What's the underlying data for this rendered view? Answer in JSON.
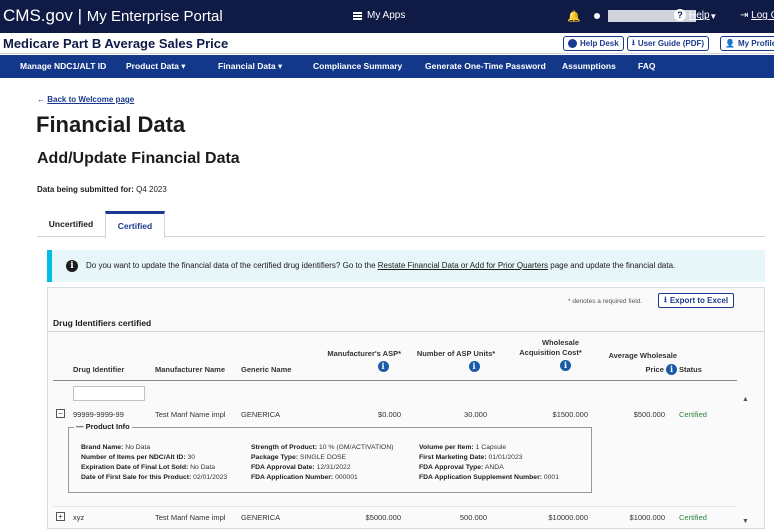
{
  "topbar": {
    "brand": "CMS.gov",
    "portal": "My Enterprise Portal",
    "myapps_label": "My Apps",
    "help_label": "Help",
    "logout_label": "Log O"
  },
  "app": {
    "title": "Medicare Part B Average Sales Price",
    "help_desk_label": "Help Desk",
    "user_guide_label": "User Guide (PDF)",
    "my_profile_label": "My Profile"
  },
  "nav": {
    "items": [
      {
        "label": "Manage NDC1/ALT ID"
      },
      {
        "label": "Product Data ▾"
      },
      {
        "label": "Financial Data ▾"
      },
      {
        "label": "Compliance Summary"
      },
      {
        "label": "Generate One-Time Password"
      },
      {
        "label": "Assumptions"
      },
      {
        "label": "FAQ"
      }
    ]
  },
  "main": {
    "back_label": "Back to Welcome page",
    "page_title": "Financial Data",
    "section_title": "Add/Update Financial Data",
    "submitted_label": "Data being submitted for:",
    "submitted_value": "Q4 2023",
    "tabs": [
      {
        "label": "Uncertified"
      },
      {
        "label": "Certified"
      }
    ],
    "alert": {
      "text_before": "Do you want to update the financial data of the certified drug identifiers? Go to the ",
      "link": "Restate Financial Data or Add for Prior Quarters",
      "text_after": " page and update the financial data."
    }
  },
  "table": {
    "required_note": "* denotes a required field.",
    "export_label": "Export to Excel",
    "section_label": "Drug Identifiers certified",
    "headers": {
      "drug_identifier": "Drug Identifier",
      "manufacturer_name": "Manufacturer Name",
      "generic_name": "Generic Name",
      "manufacturer_asp": "Manufacturer's ASP*",
      "asp_units": "Number of ASP Units*",
      "wac_line1": "Wholesale",
      "wac_line2": "Acquisition Cost*",
      "awp_line1": "Average Wholesale",
      "awp_line2": "Price",
      "status": "Status"
    },
    "rows": [
      {
        "drug_identifier": "99999-9999-99",
        "manufacturer_name": "Test Manf Name impl",
        "generic_name": "GENERICA",
        "asp": "$0.000",
        "units": "30.000",
        "wac": "$1500.000",
        "awp": "$500.000",
        "status": "Certified",
        "expander": "−"
      },
      {
        "drug_identifier": "xyz",
        "manufacturer_name": "Test Manf Name impl",
        "generic_name": "GENERICA",
        "asp": "$5000.000",
        "units": "500.000",
        "wac": "$10000.000",
        "awp": "$1000.000",
        "status": "Certified",
        "expander": "+"
      }
    ],
    "product_info": {
      "legend": "Product Info",
      "brand_name_label": "Brand Name:",
      "brand_name": "No Data",
      "items_label": "Number of Items per NDC/Alt ID:",
      "items": "30",
      "expiration_label": "Expiration Date of Final Lot Sold:",
      "expiration": "No Data",
      "first_sale_label": "Date of First Sale for this Product:",
      "first_sale": "02/01/2023",
      "strength_label": "Strength of Product:",
      "strength": "10 % (GM/ACTIVATION)",
      "package_label": "Package Type:",
      "package": "SINGLE DOSE",
      "fda_approval_date_label": "FDA Approval Date:",
      "fda_approval_date": "12/31/2022",
      "fda_app_number_label": "FDA Application Number:",
      "fda_app_number": "000001",
      "volume_label": "Volume per Item:",
      "volume": "1 Capsule",
      "first_marketing_label": "First Marketing Date:",
      "first_marketing": "01/01/2023",
      "fda_approval_type_label": "FDA Approval Type:",
      "fda_approval_type": "ANDA",
      "fda_supplement_label": "FDA Application Supplement Number:",
      "fda_supplement": "0001"
    }
  },
  "colors": {
    "topbar": "#0f1a45",
    "nav": "#13388a",
    "link": "#1a3a8f",
    "alert_bg": "#e7f6f8",
    "alert_border": "#00bde3",
    "certified": "#2e8540"
  }
}
